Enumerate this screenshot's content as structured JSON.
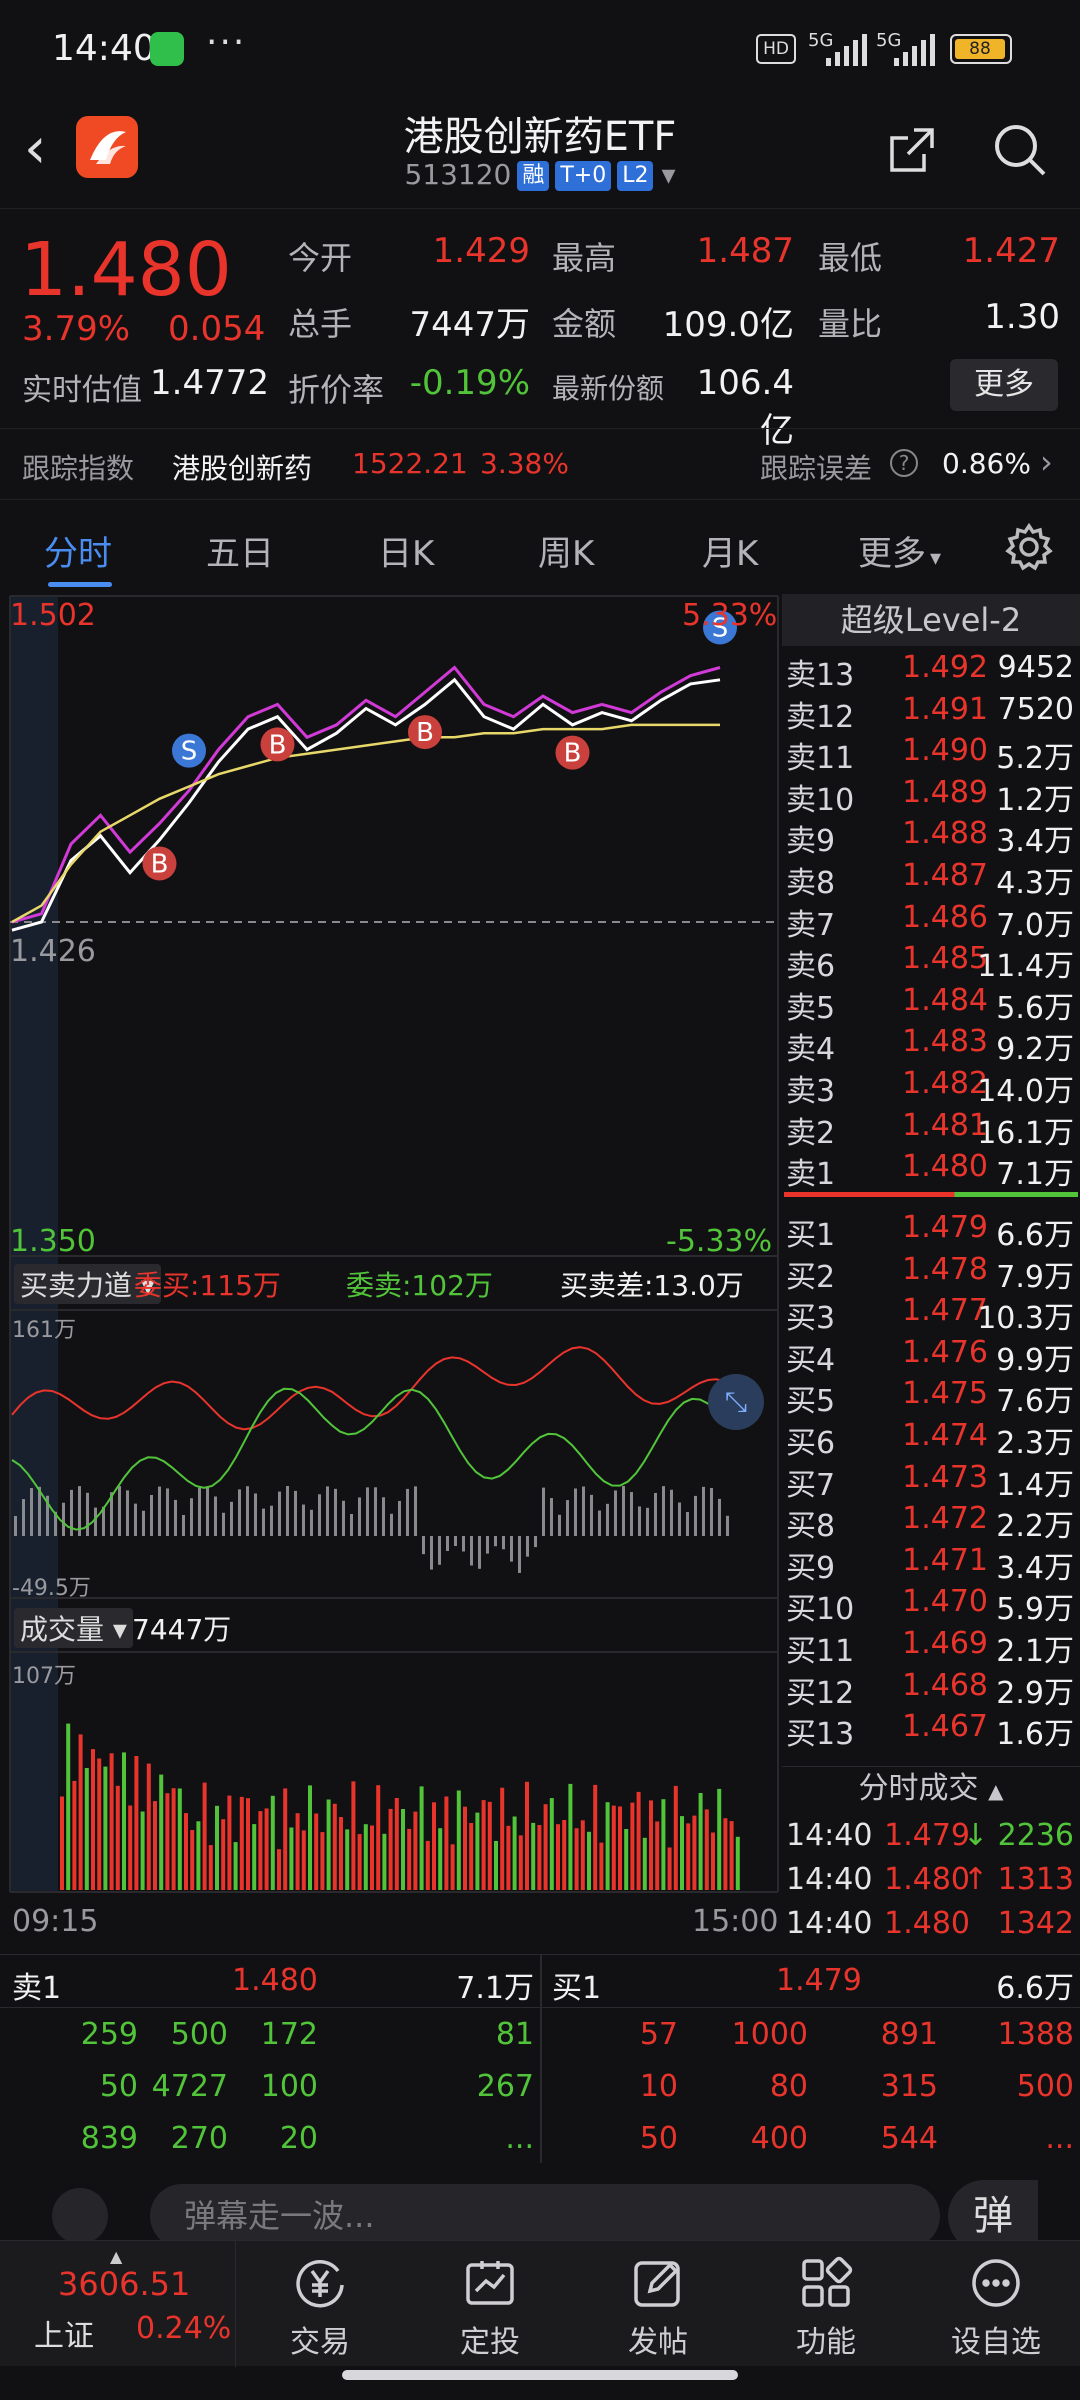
{
  "status_bar": {
    "time": "14:40",
    "dots": "···",
    "hd": "HD",
    "net1": "5G",
    "net2": "5G",
    "battery": "88"
  },
  "header": {
    "title": "港股创新药ETF",
    "code": "513120",
    "tags": [
      "融",
      "T+0",
      "L2"
    ]
  },
  "quote": {
    "price": "1.480",
    "change_pct": "3.79%",
    "change": "0.054",
    "fields": [
      {
        "label": "今开",
        "value": "1.429"
      },
      {
        "label": "最高",
        "value": "1.487"
      },
      {
        "label": "最低",
        "value": "1.427"
      },
      {
        "label": "总手",
        "value": "7447万"
      },
      {
        "label": "金额",
        "value": "109.0亿"
      },
      {
        "label": "量比",
        "value": "1.30"
      },
      {
        "label": "实时估值",
        "value": "1.4772"
      },
      {
        "label": "折价率",
        "value": "-0.19%"
      },
      {
        "label": "最新份额",
        "value": "106.4亿"
      }
    ],
    "more_label": "更多"
  },
  "tracking": {
    "label": "跟踪指数",
    "index_name": "港股创新药",
    "index_value": "1522.21",
    "index_pct": "3.38%",
    "error_label": "跟踪误差",
    "error_value": "0.86%"
  },
  "tabs": [
    "分时",
    "五日",
    "日K",
    "周K",
    "月K",
    "更多"
  ],
  "chart_labels": {
    "high": "1.502",
    "high_pct": "5.33%",
    "low": "1.350",
    "low_pct": "-5.33%",
    "mid": "1.426",
    "level2": "超级Level-2",
    "force_selector": "买卖力道",
    "entrust_buy": "委买:115万",
    "entrust_sell": "委卖:102万",
    "diff": "买卖差:13.0万",
    "force_max": "161万",
    "force_min": "-49.5万",
    "vol_selector": "成交量",
    "vol_total": "7447万",
    "vol_max": "107万",
    "time_start": "09:15",
    "time_end": "15:00",
    "marker_b": "B",
    "marker_s": "S"
  },
  "chart_data": {
    "type": "line",
    "ylim": [
      1.35,
      1.502
    ],
    "series": [
      {
        "values": [
          1.426,
          1.428,
          1.445,
          1.452,
          1.443,
          1.45,
          1.458,
          1.468,
          1.476,
          1.479,
          1.471,
          1.474,
          1.48,
          1.476,
          1.482,
          1.488,
          1.479,
          1.476,
          1.481,
          1.477,
          1.479,
          1.477,
          1.482,
          1.486,
          1.488
        ]
      },
      {
        "values": [
          1.424,
          1.426,
          1.441,
          1.447,
          1.438,
          1.446,
          1.455,
          1.465,
          1.473,
          1.476,
          1.468,
          1.472,
          1.478,
          1.474,
          1.479,
          1.485,
          1.476,
          1.473,
          1.479,
          1.474,
          1.477,
          1.475,
          1.48,
          1.484,
          1.485
        ]
      },
      {
        "values": [
          1.426,
          1.43,
          1.44,
          1.448,
          1.452,
          1.456,
          1.459,
          1.462,
          1.464,
          1.466,
          1.467,
          1.468,
          1.469,
          1.47,
          1.471,
          1.471,
          1.472,
          1.472,
          1.473,
          1.473,
          1.473,
          1.474,
          1.474,
          1.474,
          1.474
        ]
      }
    ],
    "markers": [
      {
        "type": "B",
        "index": 5
      },
      {
        "type": "S",
        "index": 6
      },
      {
        "type": "B",
        "index": 9
      },
      {
        "type": "B",
        "index": 14
      },
      {
        "type": "B",
        "index": 19
      },
      {
        "type": "S",
        "index": 24
      }
    ]
  },
  "order_book": {
    "sell": [
      {
        "name": "卖13",
        "price": "1.492",
        "vol": "9452"
      },
      {
        "name": "卖12",
        "price": "1.491",
        "vol": "7520"
      },
      {
        "name": "卖11",
        "price": "1.490",
        "vol": "5.2万"
      },
      {
        "name": "卖10",
        "price": "1.489",
        "vol": "1.2万"
      },
      {
        "name": "卖9",
        "price": "1.488",
        "vol": "3.4万"
      },
      {
        "name": "卖8",
        "price": "1.487",
        "vol": "4.3万"
      },
      {
        "name": "卖7",
        "price": "1.486",
        "vol": "7.0万"
      },
      {
        "name": "卖6",
        "price": "1.485",
        "vol": "11.4万"
      },
      {
        "name": "卖5",
        "price": "1.484",
        "vol": "5.6万"
      },
      {
        "name": "卖4",
        "price": "1.483",
        "vol": "9.2万"
      },
      {
        "name": "卖3",
        "price": "1.482",
        "vol": "14.0万"
      },
      {
        "name": "卖2",
        "price": "1.481",
        "vol": "16.1万"
      },
      {
        "name": "卖1",
        "price": "1.480",
        "vol": "7.1万"
      }
    ],
    "buy": [
      {
        "name": "买1",
        "price": "1.479",
        "vol": "6.6万"
      },
      {
        "name": "买2",
        "price": "1.478",
        "vol": "7.9万"
      },
      {
        "name": "买3",
        "price": "1.477",
        "vol": "10.3万"
      },
      {
        "name": "买4",
        "price": "1.476",
        "vol": "9.9万"
      },
      {
        "name": "买5",
        "price": "1.475",
        "vol": "7.6万"
      },
      {
        "name": "买6",
        "price": "1.474",
        "vol": "2.3万"
      },
      {
        "name": "买7",
        "price": "1.473",
        "vol": "1.4万"
      },
      {
        "name": "买8",
        "price": "1.472",
        "vol": "2.2万"
      },
      {
        "name": "买9",
        "price": "1.471",
        "vol": "3.4万"
      },
      {
        "name": "买10",
        "price": "1.470",
        "vol": "5.9万"
      },
      {
        "name": "买11",
        "price": "1.469",
        "vol": "2.1万"
      },
      {
        "name": "买12",
        "price": "1.468",
        "vol": "2.9万"
      },
      {
        "name": "买13",
        "price": "1.467",
        "vol": "1.6万"
      }
    ],
    "trades_title": "分时成交",
    "trades": [
      {
        "time": "14:40",
        "price": "1.479",
        "dir": "↓",
        "vol": "2236"
      },
      {
        "time": "14:40",
        "price": "1.480",
        "dir": "↑",
        "vol": "1313"
      },
      {
        "time": "14:40",
        "price": "1.480",
        "dir": "",
        "vol": "1342"
      }
    ]
  },
  "queue": {
    "sell_label": "卖1",
    "sell_price": "1.480",
    "sell_vol": "7.1万",
    "buy_label": "买1",
    "buy_price": "1.479",
    "buy_vol": "6.6万",
    "sell_rows": [
      [
        "259",
        "500",
        "172",
        "81"
      ],
      [
        "50",
        "4727",
        "100",
        "267"
      ],
      [
        "839",
        "270",
        "20",
        "..."
      ]
    ],
    "buy_rows": [
      [
        "57",
        "1000",
        "891",
        "1388"
      ],
      [
        "10",
        "80",
        "315",
        "500"
      ],
      [
        "50",
        "400",
        "544",
        "..."
      ]
    ]
  },
  "barrage": {
    "placeholder": "弹幕走一波...",
    "danmu": "弹"
  },
  "nav": {
    "index_value": "3606.51",
    "index_name": "上证",
    "index_pct": "0.24%",
    "items": [
      "交易",
      "定投",
      "发帖",
      "功能",
      "设自选"
    ]
  },
  "colors": {
    "up": "#e9342c",
    "down": "#52c43a",
    "accent": "#4a8df0",
    "avg": "#e8d86a",
    "price_line": "#ffffff",
    "estimate_line": "#d13ad6"
  }
}
